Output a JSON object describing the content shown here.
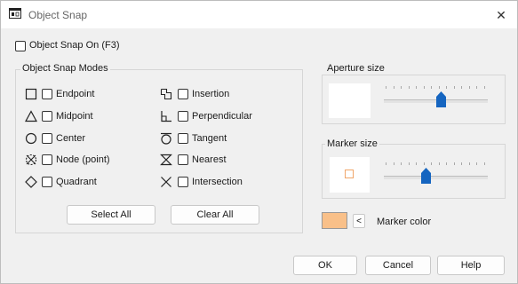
{
  "window": {
    "title": "Object Snap",
    "close_glyph": "✕"
  },
  "snap_on": {
    "label": "Object Snap On (F3)",
    "checked": false
  },
  "modes": {
    "group_title": "Object Snap Modes",
    "left": [
      {
        "id": "endpoint",
        "label": "Endpoint",
        "icon": "square-icon",
        "checked": false
      },
      {
        "id": "midpoint",
        "label": "Midpoint",
        "icon": "triangle-icon",
        "checked": false
      },
      {
        "id": "center",
        "label": "Center",
        "icon": "circle-icon",
        "checked": false
      },
      {
        "id": "node",
        "label": "Node (point)",
        "icon": "node-icon",
        "checked": false
      },
      {
        "id": "quadrant",
        "label": "Quadrant",
        "icon": "diamond-icon",
        "checked": false
      }
    ],
    "right": [
      {
        "id": "insertion",
        "label": "Insertion",
        "icon": "insertion-icon",
        "checked": false
      },
      {
        "id": "perpendicular",
        "label": "Perpendicular",
        "icon": "perpendicular-icon",
        "checked": false
      },
      {
        "id": "tangent",
        "label": "Tangent",
        "icon": "tangent-icon",
        "checked": false
      },
      {
        "id": "nearest",
        "label": "Nearest",
        "icon": "hourglass-icon",
        "checked": false
      },
      {
        "id": "intersection",
        "label": "Intersection",
        "icon": "cross-icon",
        "checked": false
      }
    ],
    "select_all": "Select All",
    "clear_all": "Clear All"
  },
  "aperture": {
    "title": "Aperture size",
    "level": 0.56
  },
  "marker": {
    "title": "Marker size",
    "level": 0.4,
    "marker_color": "#f9c089",
    "color_label": "Marker color",
    "color_button": "<"
  },
  "footer": {
    "ok": "OK",
    "cancel": "Cancel",
    "help": "Help"
  },
  "colors": {
    "accent": "#1565c0",
    "border": "#d6d6d6"
  }
}
